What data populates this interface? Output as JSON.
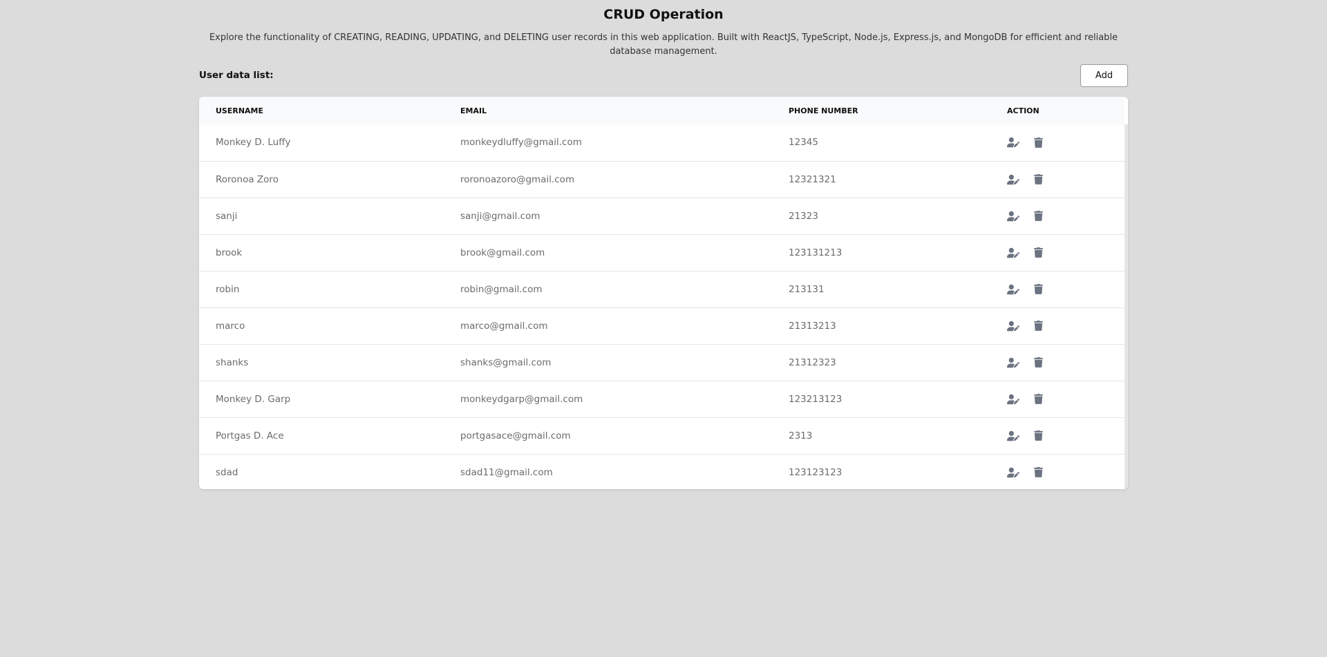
{
  "header": {
    "title": "CRUD Operation",
    "description": "Explore the functionality of CREATING, READING, UPDATING, and DELETING user records in this web application. Built with ReactJS, TypeScript, Node.js, Express.js, and MongoDB for efficient and reliable database management."
  },
  "toolbar": {
    "list_label": "User data list:",
    "add_label": "Add"
  },
  "table": {
    "columns": [
      "USERNAME",
      "EMAIL",
      "PHONE NUMBER",
      "ACTION"
    ],
    "rows": [
      {
        "username": "Monkey D. Luffy",
        "email": "monkeydluffy@gmail.com",
        "phone": "12345"
      },
      {
        "username": "Roronoa Zoro",
        "email": "roronoazoro@gmail.com",
        "phone": "12321321"
      },
      {
        "username": "sanji",
        "email": "sanji@gmail.com",
        "phone": "21323"
      },
      {
        "username": "brook",
        "email": "brook@gmail.com",
        "phone": "123131213"
      },
      {
        "username": "robin",
        "email": "robin@gmail.com",
        "phone": "213131"
      },
      {
        "username": "marco",
        "email": "marco@gmail.com",
        "phone": "21313213"
      },
      {
        "username": "shanks",
        "email": "shanks@gmail.com",
        "phone": "21312323"
      },
      {
        "username": "Monkey D. Garp",
        "email": "monkeydgarp@gmail.com",
        "phone": "123213123"
      },
      {
        "username": "Portgas D. Ace",
        "email": "portgasace@gmail.com",
        "phone": "2313"
      },
      {
        "username": "sdad",
        "email": "sdad11@gmail.com",
        "phone": "123123123"
      }
    ],
    "row_actions": [
      "user-edit-icon",
      "trash-icon"
    ]
  },
  "colors": {
    "background": "#dcdcdc",
    "card": "#ffffff",
    "header_row": "#f9fafb",
    "icon": "#6b7280",
    "cell_text": "#6b6b6b"
  }
}
